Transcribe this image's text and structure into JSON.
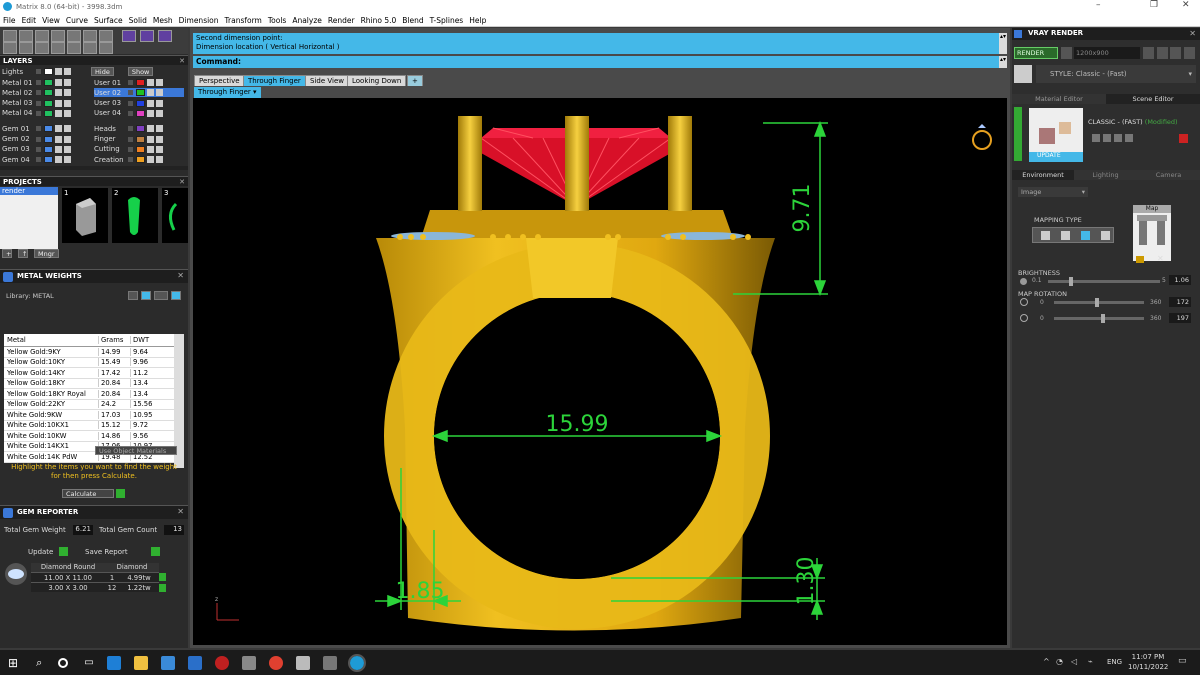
{
  "window": {
    "title": "Matrix 8.0 (64-bit) - 3998.3dm"
  },
  "menu": [
    "File",
    "Edit",
    "View",
    "Curve",
    "Surface",
    "Solid",
    "Mesh",
    "Dimension",
    "Transform",
    "Tools",
    "Analyze",
    "Render",
    "Rhino 5.0",
    "Blend",
    "T-Splines",
    "Help"
  ],
  "layers": {
    "title": "LAYERS",
    "lights_label": "Lights",
    "hide_label": "Hide",
    "show_label": "Show",
    "left": [
      {
        "name": "Metal 01",
        "color": "#20c060"
      },
      {
        "name": "Metal 02",
        "color": "#20c060"
      },
      {
        "name": "Metal 03",
        "color": "#20c060"
      },
      {
        "name": "Metal 04",
        "color": "#20c060"
      },
      {
        "name": "Gem 01",
        "color": "#4a8ae8"
      },
      {
        "name": "Gem 02",
        "color": "#4a8ae8"
      },
      {
        "name": "Gem 03",
        "color": "#4a8ae8"
      },
      {
        "name": "Gem 04",
        "color": "#4a8ae8"
      }
    ],
    "right": [
      {
        "name": "User 01",
        "color": "#e02020"
      },
      {
        "name": "User 02",
        "color": "#20c020"
      },
      {
        "name": "User 03",
        "color": "#2040e0"
      },
      {
        "name": "User 04",
        "color": "#e040c0"
      },
      {
        "name": "Heads",
        "color": "#8040c0"
      },
      {
        "name": "Finger",
        "color": "#c08040"
      },
      {
        "name": "Cutting",
        "color": "#f08020"
      },
      {
        "name": "Creation",
        "color": "#f0a020"
      }
    ]
  },
  "projects": {
    "title": "PROJECTS",
    "item": "render",
    "thumbs": [
      "1",
      "2",
      "3"
    ],
    "mngr": "Mngr"
  },
  "metal_weights": {
    "title": "METAL WEIGHTS",
    "library": "Library: METAL",
    "headers": [
      "Metal",
      "Grams",
      "DWT"
    ],
    "rows": [
      [
        "Yellow Gold:9KY",
        "14.99",
        "9.64"
      ],
      [
        "Yellow Gold:10KY",
        "15.49",
        "9.96"
      ],
      [
        "Yellow Gold:14KY",
        "17.42",
        "11.2"
      ],
      [
        "Yellow Gold:18KY",
        "20.84",
        "13.4"
      ],
      [
        "Yellow Gold:18KY Royal",
        "20.84",
        "13.4"
      ],
      [
        "Yellow Gold:22KY",
        "24.2",
        "15.56"
      ],
      [
        "White Gold:9KW",
        "17.03",
        "10.95"
      ],
      [
        "White Gold:10KX1",
        "15.12",
        "9.72"
      ],
      [
        "White Gold:10KW",
        "14.86",
        "9.56"
      ],
      [
        "White Gold:14KX1",
        "17.06",
        "10.97"
      ],
      [
        "White Gold:14K PdW",
        "19.48",
        "12.52"
      ]
    ],
    "use_object": "Use Object Materials",
    "hint": "Highlight the items you want to find the weight for then press Calculate.",
    "calculate": "Calculate"
  },
  "gem_reporter": {
    "title": "GEM REPORTER",
    "total_weight_label": "Total Gem Weight",
    "total_weight": "6.21",
    "total_count_label": "Total Gem Count",
    "total_count": "13",
    "update": "Update",
    "save_report": "Save Report",
    "headers": [
      "Diamond Round",
      "Diamond"
    ],
    "rows": [
      [
        "11.00 X 11.00",
        "1",
        "4.99tw"
      ],
      [
        "3.00 X 3.00",
        "12",
        "1.22tw"
      ]
    ]
  },
  "command": {
    "history": [
      "Second dimension point:",
      "Dimension location ( Vertical  Horizontal )"
    ],
    "prompt": "Command:"
  },
  "viewports": {
    "tabs": [
      "Perspective",
      "Through Finger",
      "Side View",
      "Looking Down",
      "+"
    ],
    "active_label": "Through Finger"
  },
  "dimensions": {
    "height": "9.71",
    "inner_width": "15.99",
    "shank_width": "1.85",
    "shank_bottom": "1.30"
  },
  "vray": {
    "title": "VRAY RENDER",
    "render": "RENDER",
    "size": "1200x900",
    "style": "STYLE:  Classic - (Fast)",
    "tabs1": [
      "Material Editor",
      "Scene Editor"
    ],
    "preset": "CLASSIC - (FAST)",
    "modified": "(Modified)",
    "update": "UPDATE",
    "tabs2": [
      "Environment",
      "Lighting",
      "Camera"
    ],
    "image_select": "Image",
    "mapping_type": "MAPPING TYPE",
    "map": "Map",
    "brightness_label": "BRIGHTNESS",
    "brightness_min": "0.1",
    "brightness_max": "5",
    "brightness": "1.06",
    "map_rotation_label": "MAP ROTATION",
    "rot1_min": "0",
    "rot1_max": "360",
    "rot1": "172",
    "rot2_min": "0",
    "rot2_max": "360",
    "rot2": "197"
  },
  "taskbar": {
    "lang": "ENG",
    "time": "11:07 PM",
    "date": "10/11/2022"
  },
  "colors": {
    "ring_gold": "#e6b214",
    "dim_green": "#2cd43a",
    "gem_red": "#e0102a",
    "cmd_blue": "#44b8e8"
  }
}
